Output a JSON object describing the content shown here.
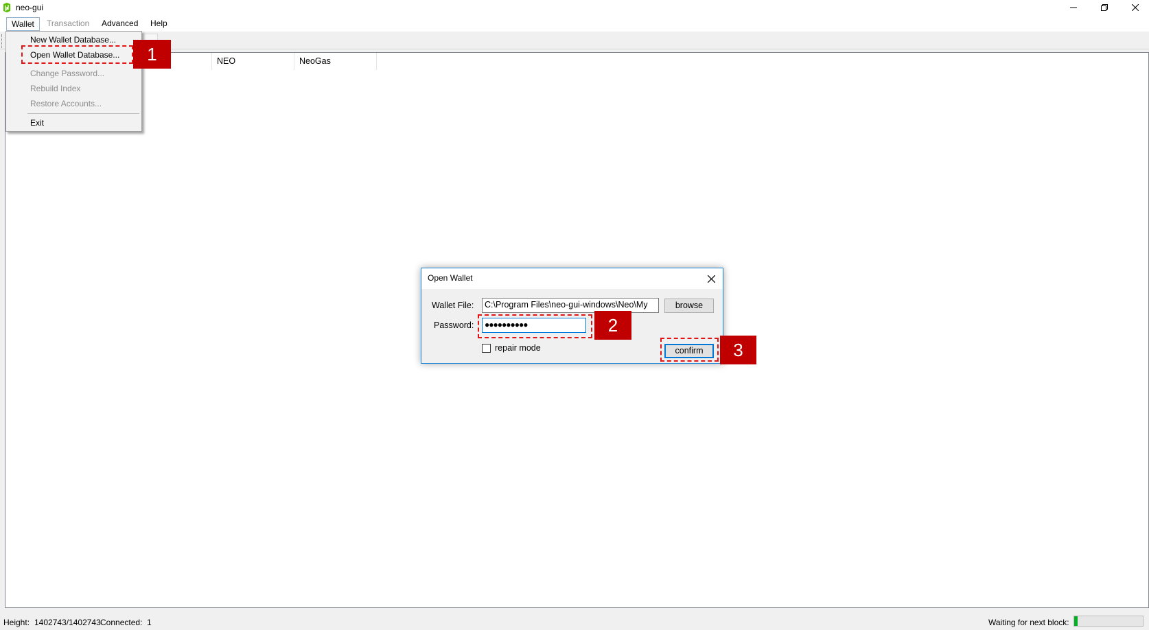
{
  "window": {
    "title": "neo-gui"
  },
  "menubar": {
    "items": [
      {
        "label": "Wallet",
        "state": "open"
      },
      {
        "label": "Transaction",
        "state": "disabled"
      },
      {
        "label": "Advanced",
        "state": "normal"
      },
      {
        "label": "Help",
        "state": "normal"
      }
    ]
  },
  "wallet_menu": {
    "items": [
      {
        "label": "New Wallet Database...",
        "enabled": true
      },
      {
        "label": "Open Wallet Database...",
        "enabled": true
      },
      {
        "label": "Change Password...",
        "enabled": false
      },
      {
        "label": "Rebuild Index",
        "enabled": false
      },
      {
        "label": "Restore Accounts...",
        "enabled": false
      },
      {
        "label": "Exit",
        "enabled": true
      }
    ]
  },
  "list": {
    "columns": [
      "NEO",
      "NeoGas"
    ]
  },
  "annotations": [
    "1",
    "2",
    "3"
  ],
  "dialog": {
    "title": "Open Wallet",
    "wallet_file_label": "Wallet File:",
    "wallet_file_value": "C:\\Program Files\\neo-gui-windows\\Neo\\My",
    "browse_label": "browse",
    "password_label": "Password:",
    "password_value": "●●●●●●●●●●",
    "repair_label": "repair mode",
    "repair_checked": false,
    "confirm_label": "confirm"
  },
  "status": {
    "height_label": "Height:",
    "height_value": "1402743/1402743",
    "connected_label": "Connected:",
    "connected_value": "1",
    "waiting_label": "Waiting for next block:",
    "progress_fraction": 0.05
  },
  "colors": {
    "accent": "#0078d7",
    "annotation": "#c00000",
    "progress": "#06b025"
  },
  "icons": [
    "neo-logo-icon",
    "minimize-icon",
    "restore-icon",
    "close-icon",
    "dialog-close-icon",
    "checkbox-icon"
  ]
}
